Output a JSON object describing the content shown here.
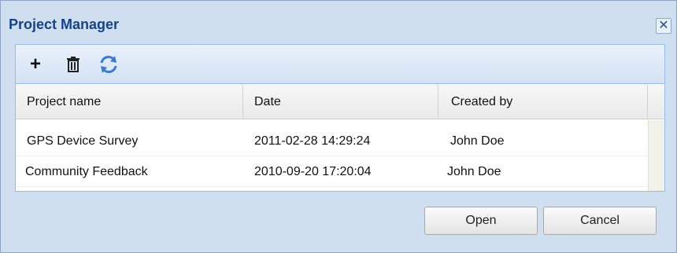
{
  "dialog": {
    "title": "Project Manager",
    "close_glyph": "✕"
  },
  "toolbar": {
    "add_icon": "plus-icon",
    "add_glyph": "+",
    "delete_icon": "trash-icon",
    "refresh_icon": "refresh-icon"
  },
  "grid": {
    "columns": [
      "Project name",
      "Date",
      "Created by"
    ],
    "rows": [
      {
        "name": "GPS Device Survey",
        "date": "2011-02-28 14:29:24",
        "created_by": "John Doe"
      },
      {
        "name": "Community Feedback",
        "date": "2010-09-20 17:20:04",
        "created_by": "John Doe"
      }
    ]
  },
  "buttons": {
    "open": "Open",
    "cancel": "Cancel"
  },
  "colors": {
    "title": "#15428b",
    "dialog_bg": "#cfdff0",
    "panel_border": "#99bbe8",
    "refresh_icon": "#3a7bd5"
  }
}
